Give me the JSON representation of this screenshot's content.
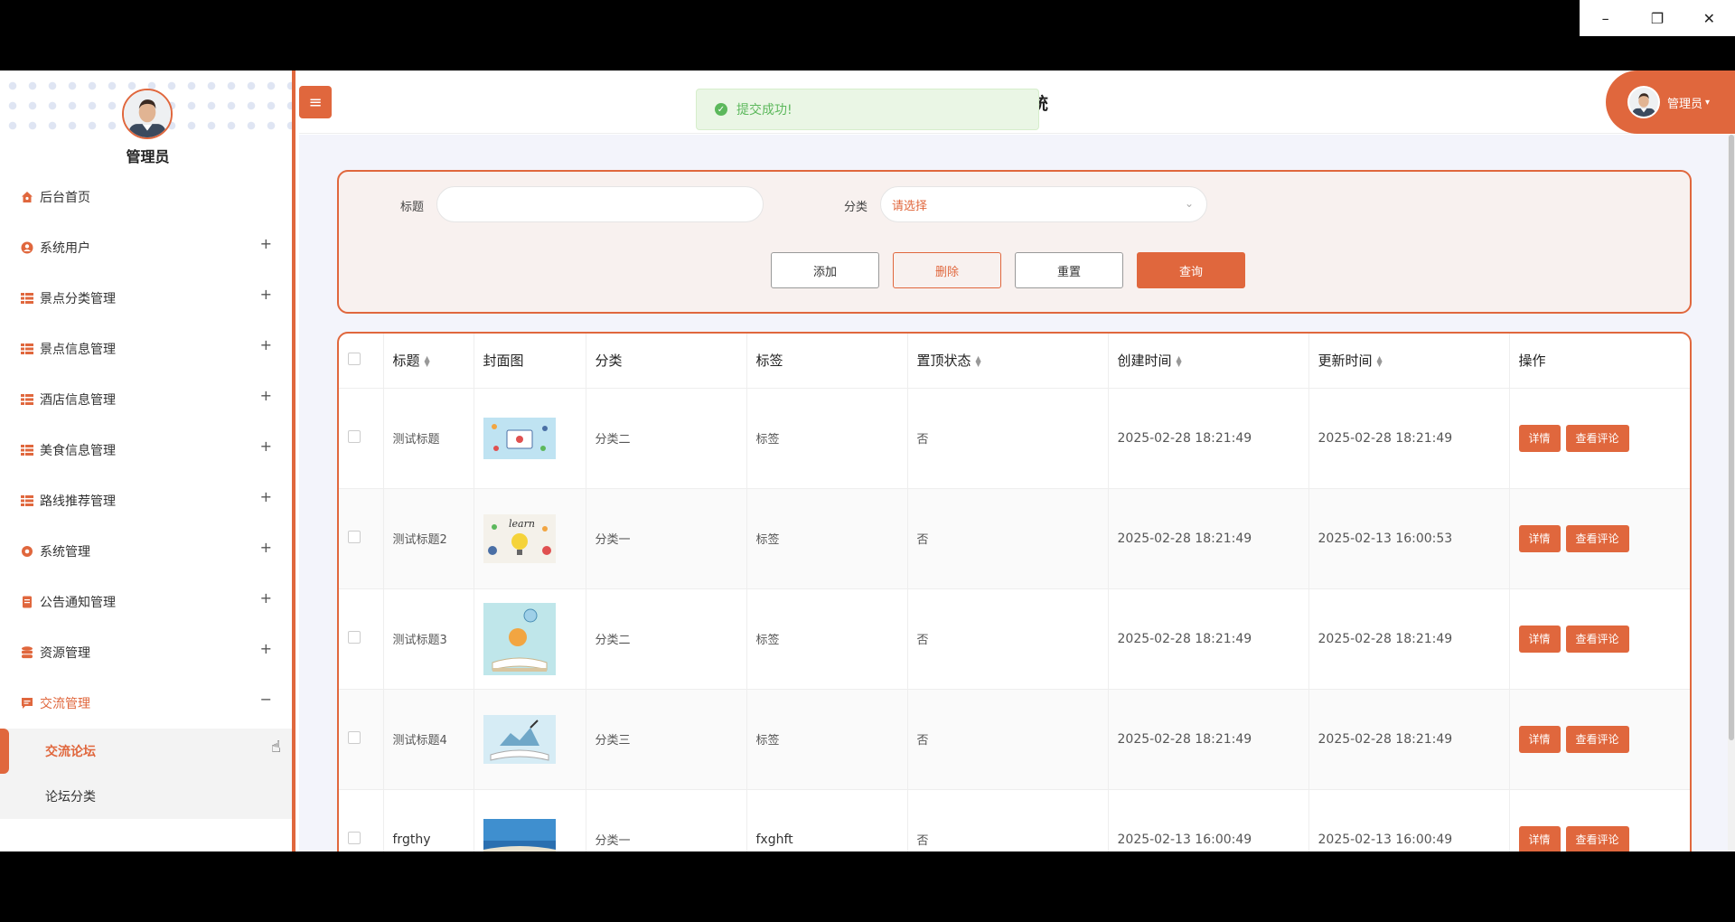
{
  "window": {
    "minimize": "–",
    "restore": "❐",
    "close": "✕"
  },
  "sidebar": {
    "user_name": "管理员",
    "menu": [
      {
        "label": "后台首页",
        "icon": "home-icon",
        "expandable": false
      },
      {
        "label": "系统用户",
        "icon": "user-icon",
        "expandable": true
      },
      {
        "label": "景点分类管理",
        "icon": "grid-icon",
        "expandable": true
      },
      {
        "label": "景点信息管理",
        "icon": "grid-icon",
        "expandable": true
      },
      {
        "label": "酒店信息管理",
        "icon": "grid-icon",
        "expandable": true
      },
      {
        "label": "美食信息管理",
        "icon": "grid-icon",
        "expandable": true
      },
      {
        "label": "路线推荐管理",
        "icon": "grid-icon",
        "expandable": true
      },
      {
        "label": "系统管理",
        "icon": "gear-icon",
        "expandable": true
      },
      {
        "label": "公告通知管理",
        "icon": "document-icon",
        "expandable": true
      },
      {
        "label": "资源管理",
        "icon": "database-icon",
        "expandable": true
      },
      {
        "label": "交流管理",
        "icon": "chat-icon",
        "expandable": true,
        "expanded": true
      }
    ],
    "plus": "+",
    "minus": "−",
    "submenu": [
      "交流论坛",
      "论坛分类"
    ]
  },
  "header": {
    "menu_toggle": "≡",
    "title_fragment": "统",
    "toast": "提交成功!",
    "user": "管理员"
  },
  "search": {
    "title_label": "标题",
    "title_value": "",
    "category_label": "分类",
    "category_placeholder": "请选择",
    "buttons": {
      "add": "添加",
      "delete": "删除",
      "reset": "重置",
      "query": "查询"
    }
  },
  "table": {
    "headers": [
      "标题",
      "封面图",
      "分类",
      "标签",
      "置顶状态",
      "创建时间",
      "更新时间",
      "操作"
    ],
    "rows": [
      {
        "title": "测试标题",
        "category": "分类二",
        "tag": "标签",
        "top": "否",
        "created": "2025-02-28 18:21:49",
        "updated": "2025-02-28 18:21:49"
      },
      {
        "title": "测试标题2",
        "category": "分类一",
        "tag": "标签",
        "top": "否",
        "created": "2025-02-28 18:21:49",
        "updated": "2025-02-13 16:00:53"
      },
      {
        "title": "测试标题3",
        "category": "分类二",
        "tag": "标签",
        "top": "否",
        "created": "2025-02-28 18:21:49",
        "updated": "2025-02-28 18:21:49"
      },
      {
        "title": "测试标题4",
        "category": "分类三",
        "tag": "标签",
        "top": "否",
        "created": "2025-02-28 18:21:49",
        "updated": "2025-02-28 18:21:49"
      },
      {
        "title": "frgthy",
        "category": "分类一",
        "tag": "fxghft",
        "top": "否",
        "created": "2025-02-13 16:00:49",
        "updated": "2025-02-13 16:00:49"
      }
    ],
    "detail_btn": "详情",
    "comment_btn": "查看评论"
  },
  "colors": {
    "accent": "#e0673d",
    "toast_green": "#5cb85c"
  }
}
